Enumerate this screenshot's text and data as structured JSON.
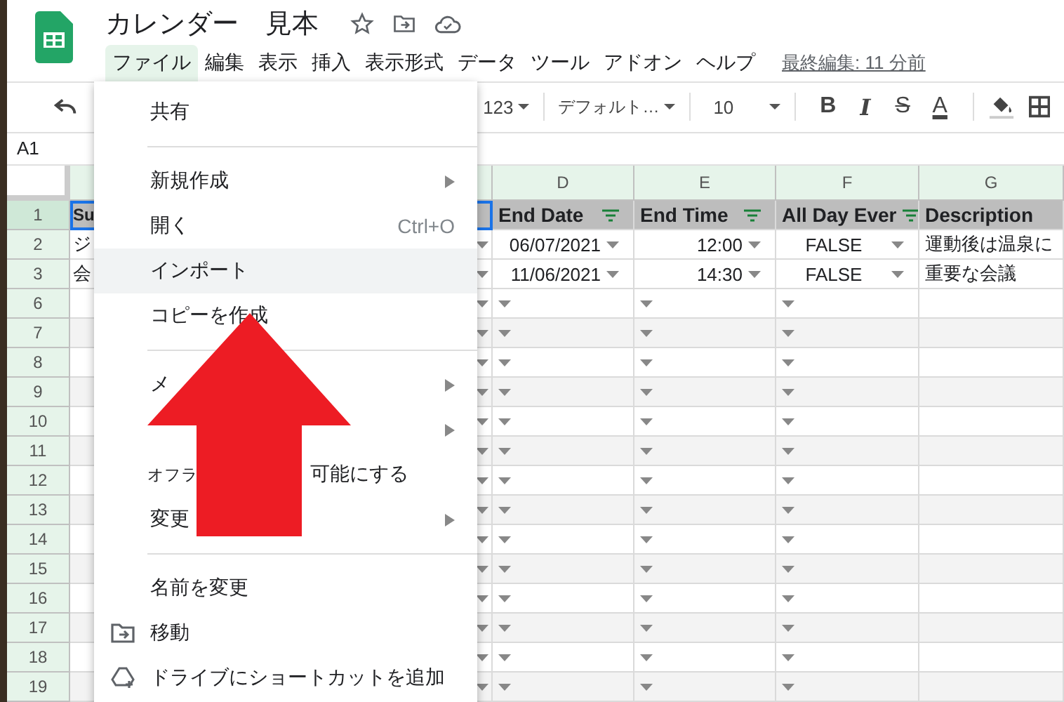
{
  "document": {
    "title": "カレンダー　見本",
    "last_edit": "最終編集: 11 分前"
  },
  "menu_bar": [
    {
      "label": "ファイル",
      "selected": true
    },
    {
      "label": "編集",
      "selected": false
    },
    {
      "label": "表示",
      "selected": false
    },
    {
      "label": "挿入",
      "selected": false
    },
    {
      "label": "表示形式",
      "selected": false
    },
    {
      "label": "データ",
      "selected": false
    },
    {
      "label": "ツール",
      "selected": false
    },
    {
      "label": "アドオン",
      "selected": false
    },
    {
      "label": "ヘルプ",
      "selected": false
    }
  ],
  "toolbar": {
    "number_format": "123",
    "font": "デフォルト…",
    "font_size": "10",
    "format_buttons": [
      {
        "label": "B",
        "kind": "bold"
      },
      {
        "label": "I",
        "kind": "italic"
      },
      {
        "label": "S",
        "kind": "strike"
      },
      {
        "label": "A",
        "kind": "color"
      }
    ]
  },
  "name_box": "A1",
  "columns": [
    "D",
    "E",
    "F",
    "G"
  ],
  "rows": [
    {
      "number": "1",
      "kind": "header",
      "selected": true,
      "shaded": false,
      "cells": [
        "Su",
        "End Date",
        "End Time",
        "All Day Ever",
        "Description"
      ]
    },
    {
      "number": "2",
      "kind": "data",
      "selected": false,
      "shaded": false,
      "cells": [
        "ジ",
        "06/07/2021",
        "12:00",
        "FALSE",
        "運動後は温泉に"
      ]
    },
    {
      "number": "3",
      "kind": "data",
      "selected": false,
      "shaded": false,
      "cells": [
        "会",
        "11/06/2021",
        "14:30",
        "FALSE",
        "重要な会議"
      ]
    },
    {
      "number": "6",
      "kind": "data",
      "selected": false,
      "shaded": false
    },
    {
      "number": "7",
      "kind": "data",
      "selected": false,
      "shaded": true
    },
    {
      "number": "8",
      "kind": "data",
      "selected": false,
      "shaded": false
    },
    {
      "number": "9",
      "kind": "data",
      "selected": false,
      "shaded": true
    },
    {
      "number": "10",
      "kind": "data",
      "selected": false,
      "shaded": false
    },
    {
      "number": "11",
      "kind": "data",
      "selected": false,
      "shaded": true
    },
    {
      "number": "12",
      "kind": "data",
      "selected": false,
      "shaded": false
    },
    {
      "number": "13",
      "kind": "data",
      "selected": false,
      "shaded": true
    },
    {
      "number": "14",
      "kind": "data",
      "selected": false,
      "shaded": false
    },
    {
      "number": "15",
      "kind": "data",
      "selected": false,
      "shaded": true
    },
    {
      "number": "16",
      "kind": "data",
      "selected": false,
      "shaded": false
    },
    {
      "number": "17",
      "kind": "data",
      "selected": false,
      "shaded": true
    },
    {
      "number": "18",
      "kind": "data",
      "selected": false,
      "shaded": false
    },
    {
      "number": "19",
      "kind": "data",
      "selected": false,
      "shaded": true
    }
  ],
  "file_menu": [
    {
      "kind": "plain",
      "label": "共有",
      "highlighted": false,
      "submenu": false
    },
    {
      "kind": "divider"
    },
    {
      "kind": "plain",
      "label": "新規作成",
      "highlighted": false,
      "submenu": true
    },
    {
      "kind": "plain",
      "label": "開く",
      "shortcut": "Ctrl+O",
      "highlighted": false,
      "submenu": false
    },
    {
      "kind": "plain",
      "label": "インポート",
      "highlighted": true,
      "submenu": false
    },
    {
      "kind": "plain",
      "label": "コピーを作成",
      "highlighted": false,
      "submenu": false
    },
    {
      "kind": "divider"
    },
    {
      "kind": "plain",
      "label": "メ",
      "highlighted": false,
      "submenu": true
    },
    {
      "kind": "plain",
      "highlighted": false,
      "submenu": true
    },
    {
      "kind": "plain",
      "label": "オフラ",
      "label_tail": "可能にする",
      "highlighted": false,
      "submenu": false
    },
    {
      "kind": "plain",
      "label": "変更",
      "highlighted": false,
      "submenu": true
    },
    {
      "kind": "divider"
    },
    {
      "kind": "plain",
      "label": "名前を変更",
      "highlighted": false,
      "submenu": false
    },
    {
      "kind": "folder",
      "label": "移動",
      "highlighted": false,
      "submenu": false
    },
    {
      "kind": "drive",
      "label": "ドライブにショートカットを追加",
      "highlighted": false,
      "submenu": false
    }
  ]
}
